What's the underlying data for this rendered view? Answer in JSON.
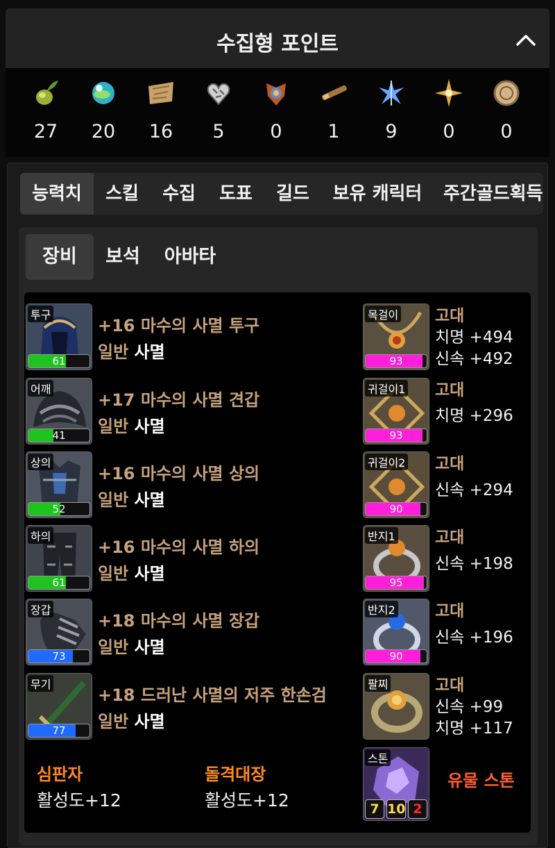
{
  "header": {
    "title": "수집형 포인트"
  },
  "collection": [
    {
      "icon": "seed-icon",
      "count": "27"
    },
    {
      "icon": "orb-icon",
      "count": "20"
    },
    {
      "icon": "map-icon",
      "count": "16"
    },
    {
      "icon": "heart-icon",
      "count": "5"
    },
    {
      "icon": "statue-icon",
      "count": "0"
    },
    {
      "icon": "telescope-icon",
      "count": "1"
    },
    {
      "icon": "leaf-icon",
      "count": "9"
    },
    {
      "icon": "compass-icon",
      "count": "0"
    },
    {
      "icon": "token-icon",
      "count": "0"
    }
  ],
  "tabs": [
    "능력치",
    "스킬",
    "수집",
    "도표",
    "길드",
    "보유 캐릭터",
    "주간골드획득"
  ],
  "subtabs": [
    "장비",
    "보석",
    "아바타"
  ],
  "equipment": [
    {
      "slot": "투구",
      "quality": 61,
      "bar_color": "#1fc31f",
      "name": "+16 마수의 사멸 투구",
      "grade": "일반",
      "set": "사멸"
    },
    {
      "slot": "어깨",
      "quality": 41,
      "bar_color": "#1fc31f",
      "name": "+17 마수의 사멸 견갑",
      "grade": "일반",
      "set": "사멸"
    },
    {
      "slot": "상의",
      "quality": 52,
      "bar_color": "#1fc31f",
      "name": "+16 마수의 사멸 상의",
      "grade": "일반",
      "set": "사멸"
    },
    {
      "slot": "하의",
      "quality": 61,
      "bar_color": "#1fc31f",
      "name": "+16 마수의 사멸 하의",
      "grade": "일반",
      "set": "사멸"
    },
    {
      "slot": "장갑",
      "quality": 73,
      "bar_color": "#1f6bff",
      "name": "+18 마수의 사멸 장갑",
      "grade": "일반",
      "set": "사멸"
    },
    {
      "slot": "무기",
      "quality": 77,
      "bar_color": "#1f6bff",
      "name": "+18 드러난 사멸의 저주 한손검",
      "grade": "일반",
      "set": "사멸"
    }
  ],
  "accessories": [
    {
      "slot": "목걸이",
      "quality": 93,
      "grade": "고대",
      "stats": [
        "치명 +494",
        "신속 +492"
      ]
    },
    {
      "slot": "귀걸이1",
      "quality": 93,
      "grade": "고대",
      "stats": [
        "치명 +296"
      ]
    },
    {
      "slot": "귀걸이2",
      "quality": 90,
      "grade": "고대",
      "stats": [
        "신속 +294"
      ]
    },
    {
      "slot": "반지1",
      "quality": 95,
      "grade": "고대",
      "stats": [
        "신속 +198"
      ]
    },
    {
      "slot": "반지2",
      "quality": 90,
      "grade": "고대",
      "stats": [
        "신속 +196"
      ]
    },
    {
      "slot": "팔찌",
      "quality": null,
      "grade": "고대",
      "stats": [
        "신속 +99",
        "치명 +117"
      ]
    }
  ],
  "accessory_bar_color": "#ff1ed9",
  "engravings": [
    {
      "name": "심판자",
      "value": "활성도+12"
    },
    {
      "name": "돌격대장",
      "value": "활성도+12"
    }
  ],
  "stone": {
    "slot": "스톤",
    "label": "유물 스톤",
    "values": [
      "7",
      "10",
      "2"
    ],
    "value_colors": [
      "#ffd84a",
      "#ffd84a",
      "#ff2a2a"
    ]
  }
}
